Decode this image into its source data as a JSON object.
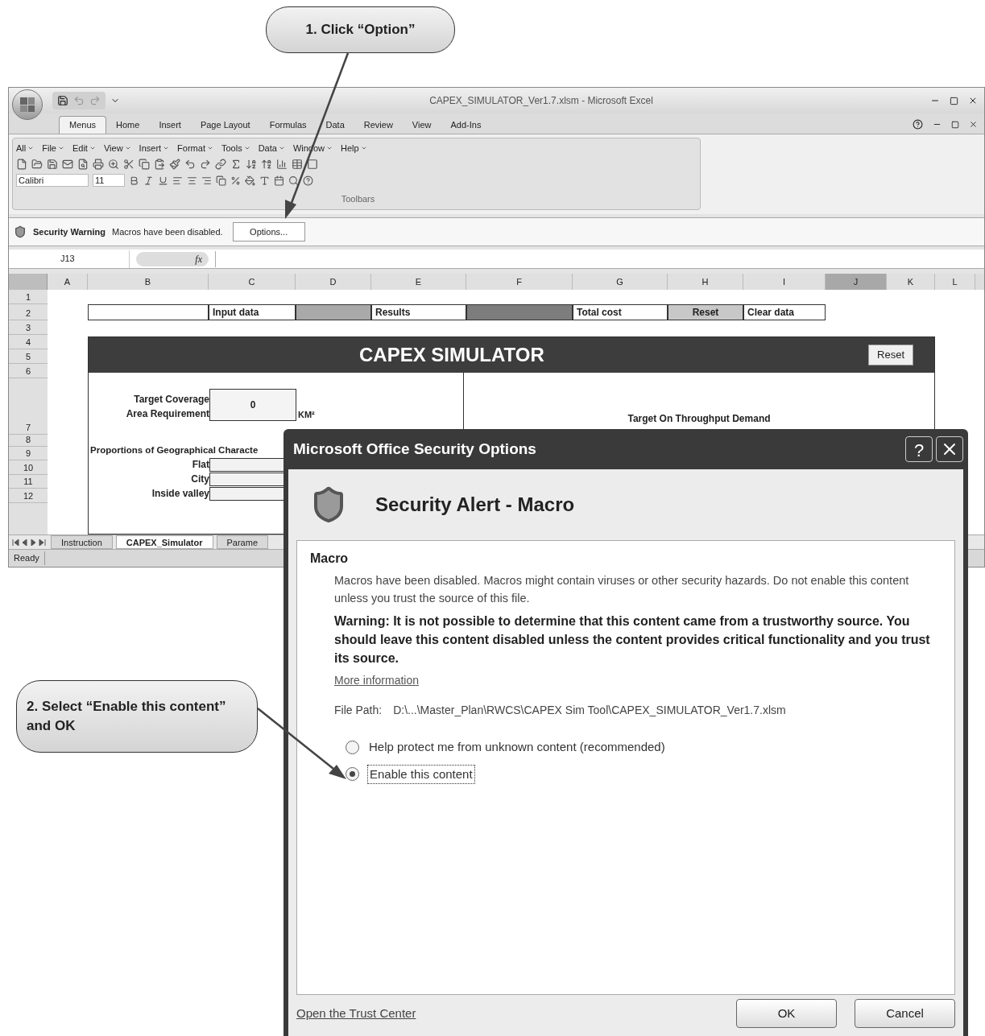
{
  "callouts": [
    {
      "text": "1. Click “Option”"
    },
    {
      "text": "2. Select “Enable this content” and OK"
    }
  ],
  "excel": {
    "title": "CAPEX_SIMULATOR_Ver1.7.xlsm - Microsoft Excel",
    "ribbon_tabs": [
      {
        "label": "Menus",
        "selected": true
      },
      {
        "label": "Home",
        "selected": false
      },
      {
        "label": "Insert",
        "selected": false
      },
      {
        "label": "Page Layout",
        "selected": false
      },
      {
        "label": "Formulas",
        "selected": false
      },
      {
        "label": "Data",
        "selected": false
      },
      {
        "label": "Review",
        "selected": false
      },
      {
        "label": "View",
        "selected": false
      },
      {
        "label": "Add-Ins",
        "selected": false
      }
    ],
    "menu_bar": [
      "All",
      "File",
      "Edit",
      "View",
      "Insert",
      "Format",
      "Tools",
      "Data",
      "Window",
      "Help"
    ],
    "font_name": "Calibri",
    "font_size": "11",
    "group_label": "Toolbars",
    "security_bar": {
      "title": "Security Warning",
      "message": "Macros have been disabled.",
      "button": "Options..."
    },
    "name_box": "J13",
    "formula_icon": "fx",
    "columns": [
      {
        "label": "A",
        "selected": false
      },
      {
        "label": "B",
        "selected": false
      },
      {
        "label": "C",
        "selected": false
      },
      {
        "label": "D",
        "selected": false
      },
      {
        "label": "E",
        "selected": false
      },
      {
        "label": "F",
        "selected": false
      },
      {
        "label": "G",
        "selected": false
      },
      {
        "label": "H",
        "selected": false
      },
      {
        "label": "I",
        "selected": false
      },
      {
        "label": "J",
        "selected": true
      },
      {
        "label": "K",
        "selected": false
      },
      {
        "label": "L",
        "selected": false
      }
    ],
    "rows": [
      "1",
      "2",
      "3",
      "4",
      "5",
      "6",
      "7",
      "8",
      "9",
      "10",
      "11",
      "12"
    ],
    "header_cells": [
      {
        "kind": "blank"
      },
      {
        "kind": "label",
        "text": "Input data"
      },
      {
        "kind": "shade"
      },
      {
        "kind": "label",
        "text": "Results"
      },
      {
        "kind": "dark"
      },
      {
        "kind": "label",
        "text": "Total cost"
      },
      {
        "kind": "button",
        "text": "Reset"
      },
      {
        "kind": "label",
        "text": "Clear data"
      }
    ],
    "simulator": {
      "title": "CAPEX SIMULATOR",
      "reset_button": "Reset",
      "coverage_label": [
        "Target Coverage",
        "Area Requirement"
      ],
      "coverage_value": "0",
      "unit": "KM²",
      "proportions_label": "Proportions of Geographical Characte",
      "proportions": [
        "Flat",
        "City",
        "Inside valley"
      ],
      "right_heading": "Target On Throughput Demand"
    },
    "sheet_tabs": [
      {
        "label": "Instruction",
        "selected": false
      },
      {
        "label": "CAPEX_Simulator",
        "selected": true
      },
      {
        "label": "Parame",
        "selected": false
      }
    ],
    "status": "Ready"
  },
  "dialog": {
    "title": "Microsoft Office Security Options",
    "help_button": "?",
    "alert_title": "Security Alert - Macro",
    "section": "Macro",
    "description": "Macros have been disabled. Macros might contain viruses or other security hazards. Do not enable this content unless you trust the source of this file.",
    "warning": "Warning: It is not possible to determine that this content came from a trustworthy source. You should leave this content disabled unless the content provides critical functionality and you trust its source.",
    "more_info": "More information",
    "file_path_label": "File Path:",
    "file_path": "D:\\...\\Master_Plan\\RWCS\\CAPEX Sim Tool\\CAPEX_SIMULATOR_Ver1.7.xlsm",
    "options": [
      {
        "label": "Help protect me from unknown content (recommended)",
        "selected": false
      },
      {
        "label": "Enable this content",
        "selected": true
      }
    ],
    "trust_center": "Open the Trust Center",
    "buttons": [
      "OK",
      "Cancel"
    ]
  }
}
